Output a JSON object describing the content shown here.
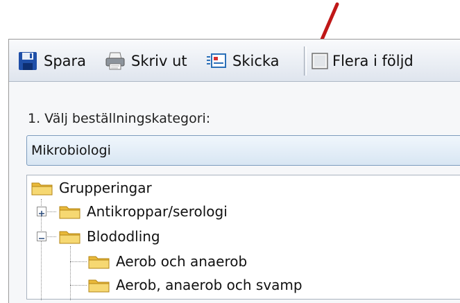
{
  "toolbar": {
    "save_label": "Spara",
    "print_label": "Skriv ut",
    "send_label": "Skicka",
    "multi_label": "Flera i följd",
    "multi_checked": false
  },
  "form": {
    "step_label": "1. Välj beställningskategori:",
    "category_value": "Mikrobiologi"
  },
  "tree": {
    "root": "Grupperingar",
    "items": [
      {
        "label": "Antikroppar/serologi",
        "state": "collapsed"
      },
      {
        "label": "Blododling",
        "state": "expanded"
      },
      {
        "label": "Aerob och anaerob",
        "state": "leaf"
      },
      {
        "label": "Aerob, anaerob och svamp",
        "state": "leaf"
      }
    ]
  },
  "colors": {
    "annotation_arrow": "#c01818",
    "folder": "#f2c94c"
  }
}
